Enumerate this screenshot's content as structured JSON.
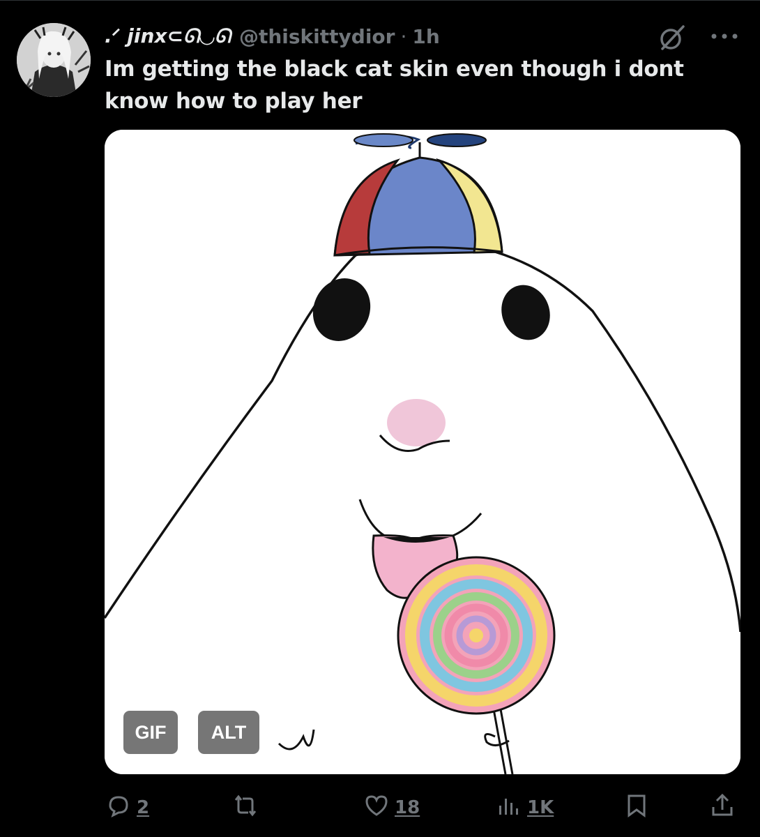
{
  "tweet": {
    "display_name": ".ᐟ jinx⊂ᘏ◡ᘏ",
    "handle": "@thiskittydior",
    "separator": "·",
    "time": "1h",
    "text": "Im getting the black cat skin even though i dont know how to play her"
  },
  "media": {
    "type_badge": "GIF",
    "alt_badge": "ALT"
  },
  "actions": {
    "replies": "2",
    "likes": "18",
    "views": "1K"
  },
  "icons": {
    "grok": "grok-slash-circle-icon",
    "more": "more-horizontal-icon",
    "reply": "reply-bubble-icon",
    "repost": "repost-icon",
    "like": "heart-icon",
    "views": "bar-chart-icon",
    "bookmark": "bookmark-icon",
    "share": "share-upload-icon"
  },
  "colors": {
    "background": "#000000",
    "text_primary": "#e7e9ea",
    "text_secondary": "#71767b"
  }
}
